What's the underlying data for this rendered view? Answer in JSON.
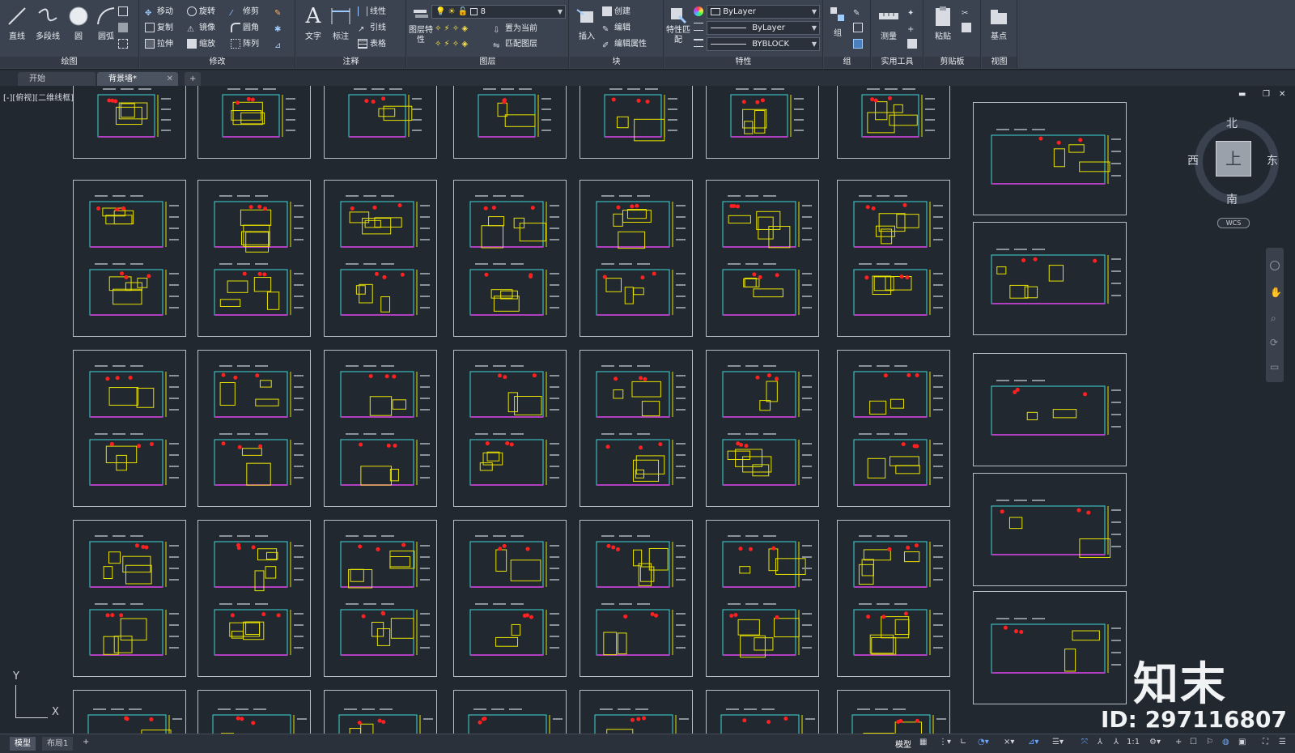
{
  "ribbon": {
    "panels": {
      "draw": "绘图",
      "modify": "修改",
      "annotate": "注释",
      "layers": "图层",
      "block": "块",
      "properties": "特性",
      "group": "组",
      "utilities": "实用工具",
      "clipboard": "剪贴板",
      "view": "视图"
    },
    "draw": {
      "line": "直线",
      "polyline": "多段线",
      "circle": "圆",
      "arc": "圆弧"
    },
    "modify": {
      "move": "移动",
      "rotate": "旋转",
      "trim": "修剪",
      "copy": "复制",
      "mirror": "镜像",
      "fillet": "圆角",
      "stretch": "拉伸",
      "scale": "缩放",
      "array": "阵列"
    },
    "annotate": {
      "text": "文字",
      "dimension": "标注",
      "linear": "线性",
      "leader": "引线",
      "table": "表格"
    },
    "layers": {
      "layer_props": "图层特性",
      "current_layer": "8",
      "make_current": "置为当前",
      "match_layer": "匹配图层"
    },
    "block": {
      "insert": "插入",
      "create": "创建",
      "edit": "编辑",
      "edit_attr": "编辑属性"
    },
    "properties": {
      "match": "特性匹配",
      "color": "ByLayer",
      "linetype": "ByLayer",
      "lineweight": "BYBLOCK"
    },
    "group": {
      "group": "组"
    },
    "utilities": {
      "measure": "测量"
    },
    "clipboard": {
      "paste": "粘贴"
    },
    "view": {
      "base": "基点"
    }
  },
  "tabs": [
    {
      "label": "开始"
    },
    {
      "label": "背景墙*"
    }
  ],
  "viewport": {
    "label": "[-][俯视][二维线框]",
    "compass": {
      "north": "北",
      "south": "南",
      "east": "东",
      "west": "西",
      "top": "上"
    },
    "wcs": "WCS",
    "ucs_x": "X",
    "ucs_y": "Y"
  },
  "watermark": {
    "brand": "知末",
    "id": "ID: 297116807"
  },
  "statusbar": {
    "layouts": [
      "模型",
      "布局1"
    ],
    "model": "模型",
    "scale": "1:1"
  },
  "colors": {
    "ribbon_bg": "#3b4350",
    "canvas_bg": "#212830",
    "drawing_yellow": "#e8e200",
    "drawing_cyan": "#3fd6d6",
    "drawing_red": "#ff2020",
    "drawing_magenta": "#b040c0"
  }
}
